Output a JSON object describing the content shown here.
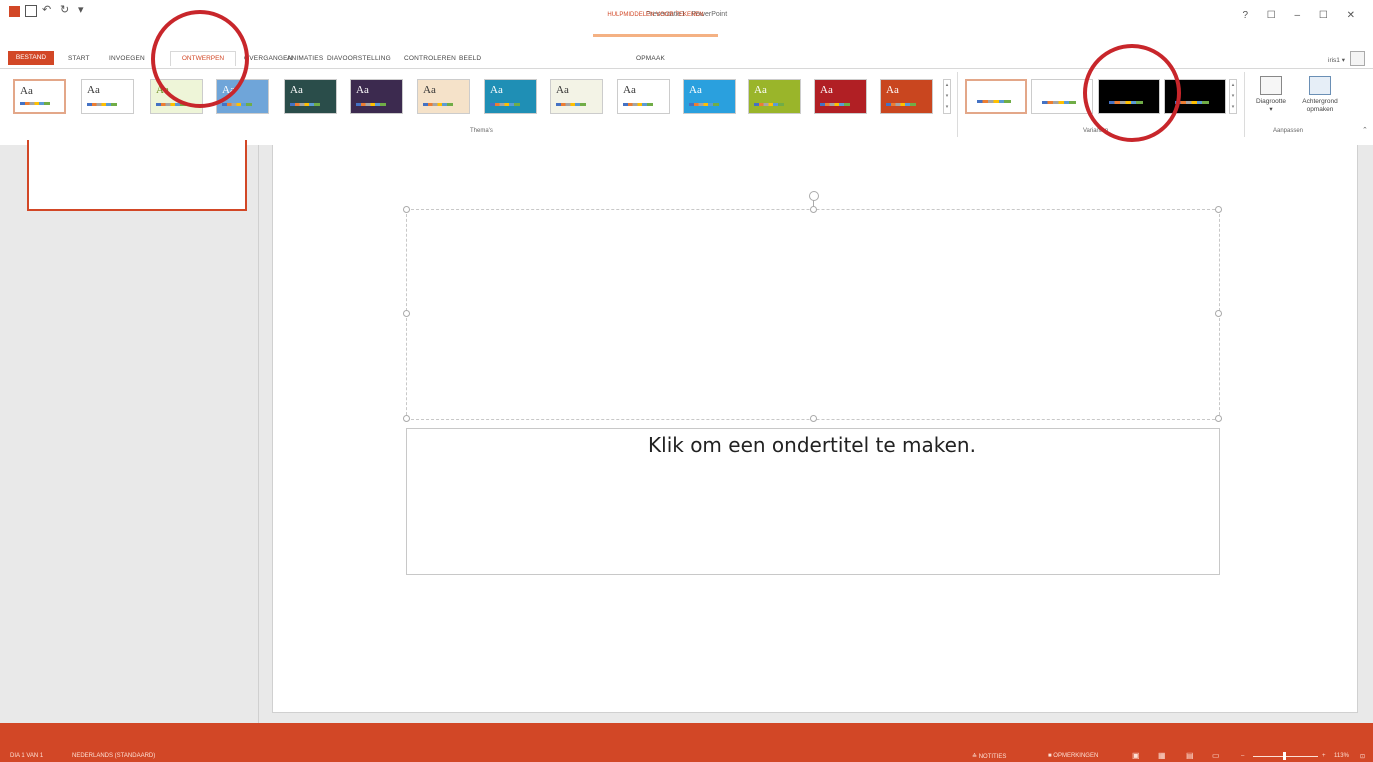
{
  "app": {
    "title": "Presentatie1 - PowerPoint",
    "contextual_group": "HULPMIDDELEN VOOR TEKENEN",
    "window_controls": "? ☐ – ☐ ✕",
    "user": "iris1 ▾"
  },
  "quick_access": {
    "icons": [
      "powerpoint-logo-icon",
      "save-icon",
      "undo-icon",
      "redo-icon",
      "customize-icon"
    ]
  },
  "tabs": [
    {
      "label": "BESTAND"
    },
    {
      "label": "START"
    },
    {
      "label": "INVOEGEN"
    },
    {
      "label": "ONTWERPEN",
      "active": true
    },
    {
      "label": "OVERGANGEN"
    },
    {
      "label": "ANIMATIES"
    },
    {
      "label": "DIAVOORSTELLING"
    },
    {
      "label": "CONTROLEREN"
    },
    {
      "label": "BEELD"
    },
    {
      "label": "OPMAAK"
    }
  ],
  "ribbon": {
    "themes": {
      "label": "Thema's",
      "items": [
        {
          "text": "Aa",
          "bg": "#ffffff",
          "fg": "#333333"
        },
        {
          "text": "Aa",
          "bg": "#ffffff",
          "fg": "#333333"
        },
        {
          "text": "Aa",
          "bg": "#eef5d8",
          "fg": "#6a8a1a"
        },
        {
          "text": "Aa",
          "bg": "#6fa5d9",
          "fg": "#ffffff"
        },
        {
          "text": "Aa",
          "bg": "#2a4d4a",
          "fg": "#ffffff"
        },
        {
          "text": "Aa",
          "bg": "#3c2a4f",
          "fg": "#ffffff"
        },
        {
          "text": "Aa",
          "bg": "#f5e2c9",
          "fg": "#333333"
        },
        {
          "text": "Aa",
          "bg": "#1f8fb5",
          "fg": "#ffffff"
        },
        {
          "text": "Aa",
          "bg": "#f3f3e6",
          "fg": "#333333"
        },
        {
          "text": "Aa",
          "bg": "#ffffff",
          "fg": "#333333"
        },
        {
          "text": "Aa",
          "bg": "#2aa0de",
          "fg": "#ffffff"
        },
        {
          "text": "Aa",
          "bg": "#9ab52a",
          "fg": "#ffffff"
        },
        {
          "text": "Aa",
          "bg": "#b11f24",
          "fg": "#ffffff"
        },
        {
          "text": "Aa",
          "bg": "#c9461f",
          "fg": "#ffffff"
        }
      ]
    },
    "variants": {
      "label": "Varianten",
      "items": [
        {
          "bg": "#ffffff"
        },
        {
          "bg": "#ffffff"
        },
        {
          "bg": "#000000"
        },
        {
          "bg": "#000000"
        }
      ]
    },
    "customize": {
      "label": "Aanpassen",
      "slide_size": "Diagrootte",
      "format_background_line1": "Achtergrond",
      "format_background_line2": "opmaken"
    }
  },
  "slide": {
    "subtitle_placeholder": "Klik om een ondertitel te maken."
  },
  "statusbar": {
    "slide_info": "DIA 1 VAN 1",
    "language": "NEDERLANDS (STANDAARD)",
    "notes": "NOTITIES",
    "comments": "OPMERKINGEN",
    "zoom": "113%"
  }
}
